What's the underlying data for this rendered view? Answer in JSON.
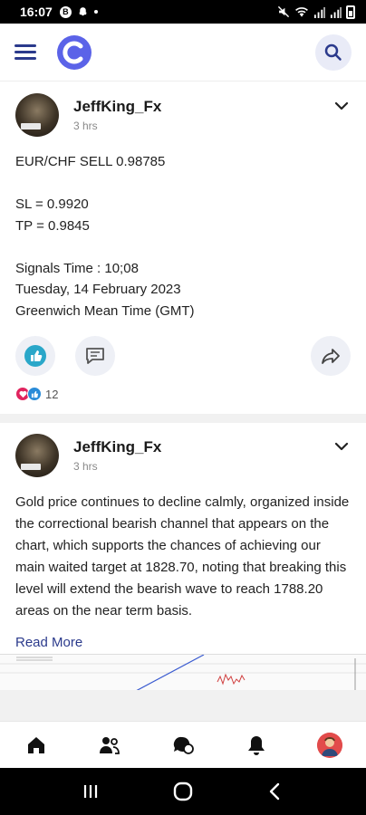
{
  "status_bar": {
    "time": "16:07",
    "left_icons": [
      "b-circle-icon",
      "snapchat-icon",
      "dot-icon"
    ],
    "right_icons": [
      "mute-icon",
      "wifi-icon",
      "signal-icon",
      "signal-icon",
      "battery-icon"
    ]
  },
  "app_bar": {
    "menu_icon": "hamburger-icon",
    "logo_icon": "app-logo-c-icon",
    "search_icon": "search-icon",
    "colors": {
      "accent": "#2b3a8c",
      "logo": "#5b63e8",
      "search_bg": "#e9ebf7"
    }
  },
  "posts": [
    {
      "author": "JeffKing_Fx",
      "time": "3 hrs",
      "body": "EUR/CHF SELL 0.98785\n\nSL = 0.9920\nTP = 0.9845\n\nSignals Time : 10;08\nTuesday, 14 February 2023\nGreenwich Mean Time (GMT)",
      "reaction_count": "12",
      "reaction_icons": [
        "heart-icon",
        "thumbs-up-icon"
      ]
    },
    {
      "author": "JeffKing_Fx",
      "time": "3 hrs",
      "body": "Gold price continues to decline calmly, organized inside the correctional bearish channel that appears on the chart, which supports the chances of achieving our main waited target at 1828.70, noting that breaking this level will extend the bearish wave to reach 1788.20 areas on the near term basis.",
      "read_more": "Read More"
    }
  ],
  "bottom_nav": [
    "home-icon",
    "users-icon",
    "chat-icon",
    "bell-icon",
    "profile-avatar"
  ],
  "system_nav": [
    "recents-icon",
    "home-circle-icon",
    "back-icon"
  ]
}
